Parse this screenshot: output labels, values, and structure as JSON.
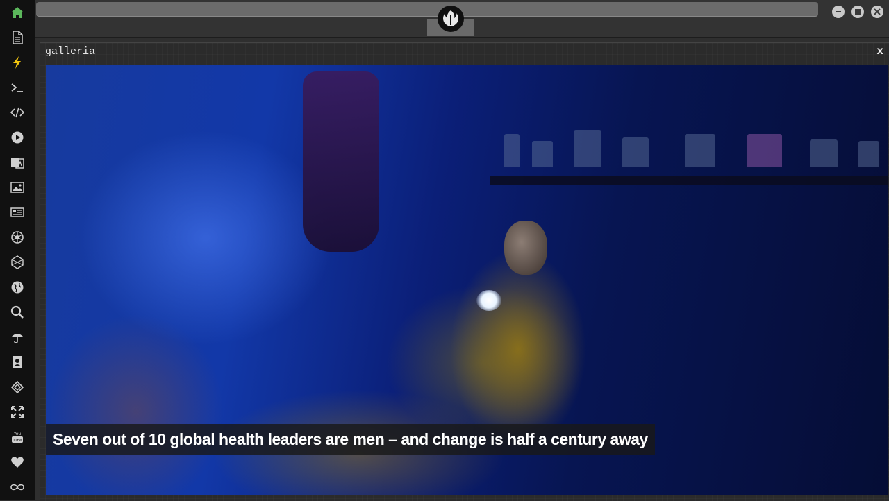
{
  "window": {
    "controls": [
      "minimize",
      "maximize",
      "close"
    ]
  },
  "sidebar": {
    "items": [
      {
        "icon": "home-icon",
        "active": true
      },
      {
        "icon": "document-icon"
      },
      {
        "icon": "lightning-icon"
      },
      {
        "icon": "terminal-icon"
      },
      {
        "icon": "code-icon"
      },
      {
        "icon": "play-icon"
      },
      {
        "icon": "translate-icon"
      },
      {
        "icon": "image-icon"
      },
      {
        "icon": "newspaper-icon"
      },
      {
        "icon": "rebel-alliance-icon"
      },
      {
        "icon": "galactic-empire-icon"
      },
      {
        "icon": "globe-icon"
      },
      {
        "icon": "search-icon"
      },
      {
        "icon": "umbrella-icon"
      },
      {
        "icon": "contact-icon"
      },
      {
        "icon": "codepen-icon"
      },
      {
        "icon": "expand-icon"
      },
      {
        "icon": "youtube-icon"
      },
      {
        "icon": "heart-icon"
      },
      {
        "icon": "infinity-icon"
      }
    ]
  },
  "panel": {
    "title": "galleria",
    "close_label": "x"
  },
  "gallery": {
    "caption": "Seven out of 10 global health leaders are men – and change is half a century away"
  },
  "colors": {
    "active_icon": "#5cb85c",
    "icon": "#cfcfcf",
    "sidebar_bg": "#111111",
    "topbar_bg": "#333333"
  }
}
